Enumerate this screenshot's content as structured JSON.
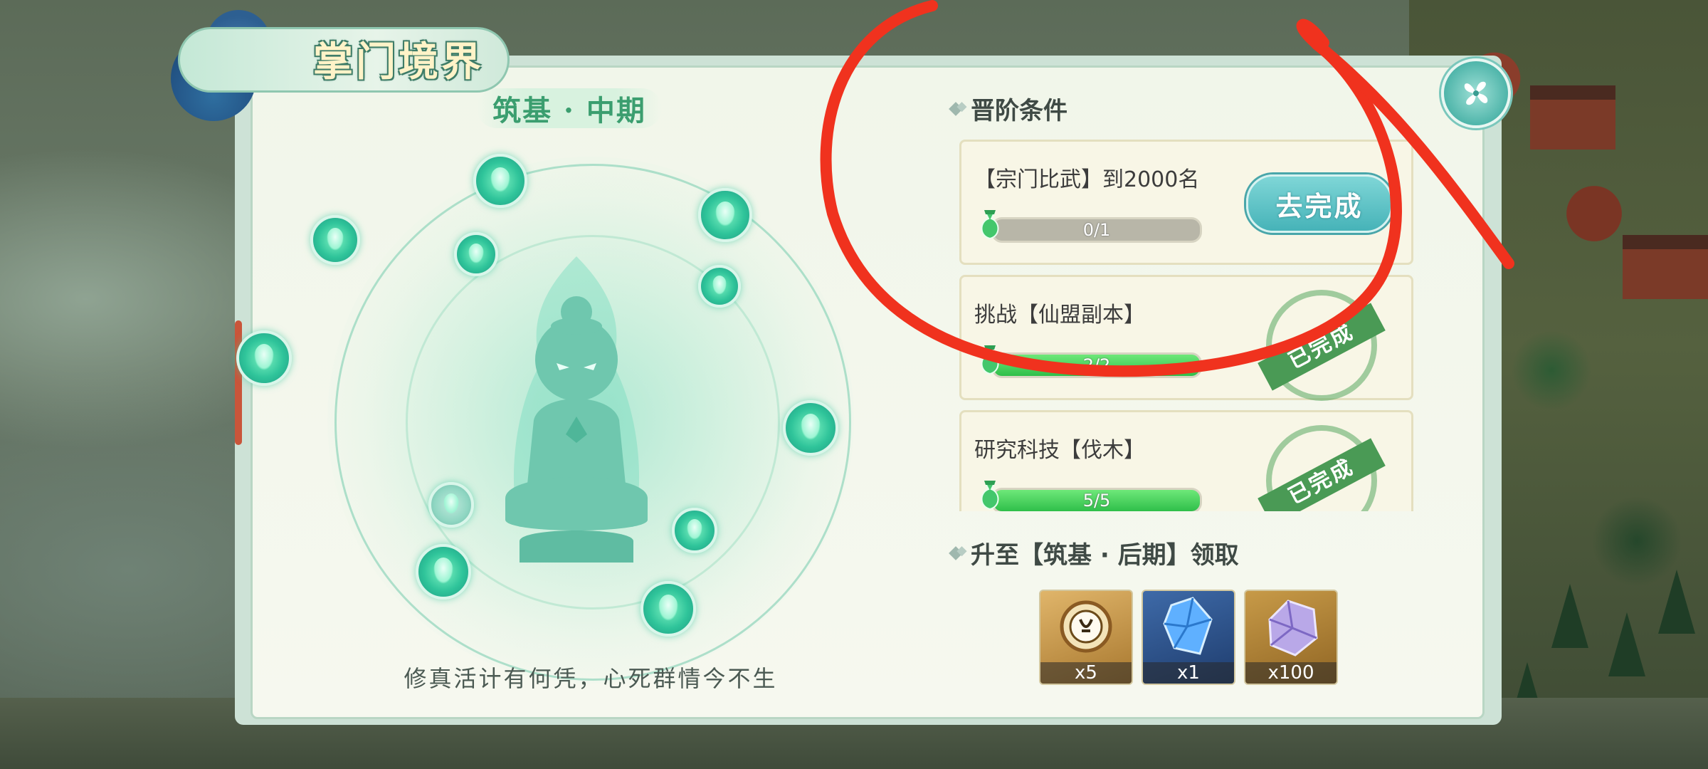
{
  "window": {
    "title": "掌门境界"
  },
  "realm": {
    "stage": "筑基 · 中期",
    "motto": "修真活计有何凭，心死群情今不生"
  },
  "conditions": {
    "heading": "晋阶条件",
    "items": [
      {
        "title": "【宗门比武】到2000名",
        "progress_text": "0/1",
        "progress": 0.0,
        "action": "去完成",
        "completed": false
      },
      {
        "title": "挑战【仙盟副本】",
        "progress_text": "2/2",
        "progress": 1.0,
        "stamp": "已完成",
        "completed": true
      },
      {
        "title": "研究科技【伐木】",
        "progress_text": "5/5",
        "progress": 1.0,
        "stamp": "已完成",
        "completed": true
      }
    ]
  },
  "rewards": {
    "heading": "升至【筑基 · 后期】领取",
    "items": [
      {
        "icon": "token-icon",
        "count": "x5",
        "color": "#b88a3e"
      },
      {
        "icon": "blue-crystal-icon",
        "count": "x1",
        "color": "#2f5d99"
      },
      {
        "icon": "purple-stone-icon",
        "count": "x100",
        "color": "#b08a3a"
      }
    ]
  },
  "colors": {
    "accent_green": "#3b9e6f",
    "progress_green": "#2fbf4a",
    "button_teal": "#46b3b8",
    "annotation_red": "#f0321e"
  }
}
